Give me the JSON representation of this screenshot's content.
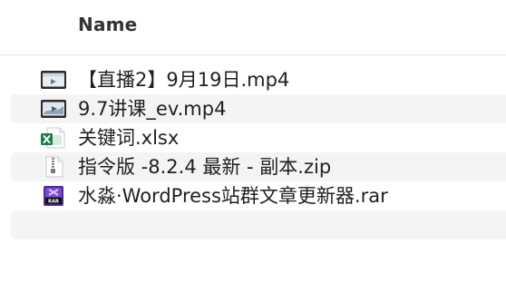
{
  "header": {
    "column_name": "Name"
  },
  "files": [
    {
      "name": "【直播2】9月19日.mp4",
      "icon": "video-file-icon"
    },
    {
      "name": "9.7讲课_ev.mp4",
      "icon": "video-file-icon"
    },
    {
      "name": "关键词.xlsx",
      "icon": "excel-file-icon"
    },
    {
      "name": "指令版 -8.2.4 最新 - 副本.zip",
      "icon": "zip-file-icon"
    },
    {
      "name": "水淼·WordPress站群文章更新器.rar",
      "icon": "rar-file-icon"
    }
  ],
  "colors": {
    "row_stripe": "#f4f4f5",
    "excel_green": "#1e7c45",
    "rar_purple": "#5b2f9f",
    "text": "#1f1f1f"
  }
}
